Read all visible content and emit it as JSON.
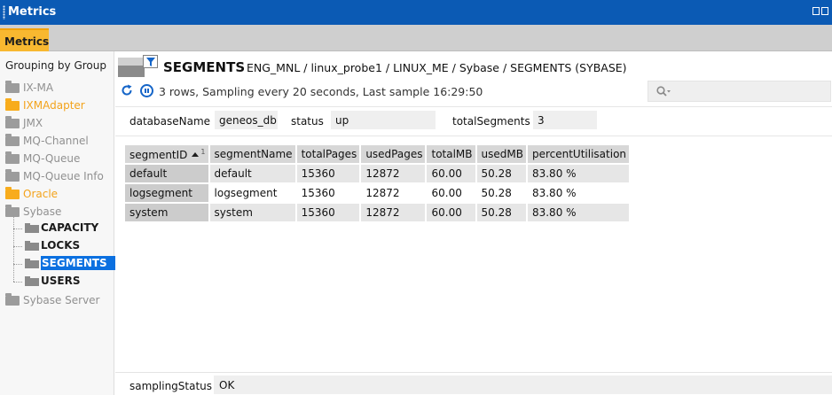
{
  "window": {
    "title": "Metrics"
  },
  "tabs": [
    {
      "label": "Metrics",
      "active": true
    }
  ],
  "sidebar": {
    "heading": "Grouping by Group",
    "groups": [
      {
        "label": "IX-MA",
        "highlighted": false
      },
      {
        "label": "IXMAdapter",
        "highlighted": true
      },
      {
        "label": "JMX",
        "highlighted": false
      },
      {
        "label": "MQ-Channel",
        "highlighted": false
      },
      {
        "label": "MQ-Queue",
        "highlighted": false
      },
      {
        "label": "MQ-Queue Info",
        "highlighted": false
      },
      {
        "label": "Oracle",
        "highlighted": true
      },
      {
        "label": "Sybase",
        "highlighted": false
      }
    ],
    "sybase_children": [
      {
        "label": "CAPACITY",
        "selected": false
      },
      {
        "label": "LOCKS",
        "selected": false
      },
      {
        "label": "SEGMENTS",
        "selected": true
      },
      {
        "label": "USERS",
        "selected": false
      }
    ],
    "last_group": {
      "label": "Sybase Server",
      "highlighted": false
    }
  },
  "dataview": {
    "name": "SEGMENTS",
    "path": "ENG_MNL / linux_probe1 / LINUX_ME / Sybase / SEGMENTS (SYBASE)",
    "sample_info": "3 rows, Sampling every 20 seconds, Last sample 16:29:50",
    "search": {
      "placeholder": "",
      "value": ""
    }
  },
  "headlines": [
    {
      "name": "databaseName",
      "value": "geneos_db"
    },
    {
      "name": "status",
      "value": "up"
    },
    {
      "name": "totalSegments",
      "value": "3"
    }
  ],
  "table": {
    "columns": [
      "segmentID",
      "segmentName",
      "totalPages",
      "usedPages",
      "totalMB",
      "usedMB",
      "percentUtilisation"
    ],
    "sort": {
      "column": "segmentID",
      "direction": "ascending",
      "index": "1"
    },
    "rows": [
      [
        "default",
        "default",
        "15360",
        "12872",
        "60.00",
        "50.28",
        "83.80 %"
      ],
      [
        "logsegment",
        "logsegment",
        "15360",
        "12872",
        "60.00",
        "50.28",
        "83.80 %"
      ],
      [
        "system",
        "system",
        "15360",
        "12872",
        "60.00",
        "50.28",
        "83.80 %"
      ]
    ]
  },
  "footer": {
    "name": "samplingStatus",
    "value": "OK"
  },
  "colors": {
    "title_bar": "#0b5ab4",
    "tab_active": "#f8b830",
    "highlight_group": "#f3a31b",
    "selection": "#0b70e0"
  },
  "icons": [
    "grip-icon",
    "window-buttons-icon",
    "folder-icon",
    "dataview-icon",
    "filter-icon",
    "refresh-icon",
    "pause-icon",
    "search-icon",
    "sort-ascending-icon"
  ]
}
